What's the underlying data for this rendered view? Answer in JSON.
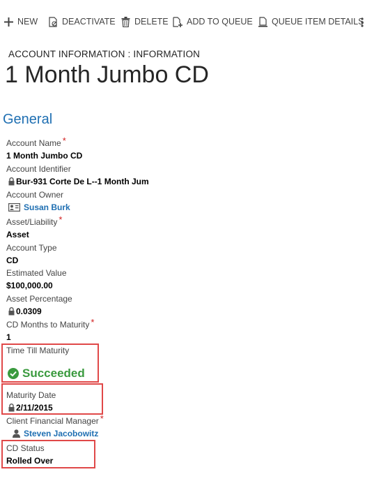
{
  "toolbar": {
    "new_label": "NEW",
    "deactivate_label": "DEACTIVATE",
    "delete_label": "DELETE",
    "add_to_queue_label": "ADD TO QUEUE",
    "queue_item_details_label": "QUEUE ITEM DETAILS"
  },
  "header": {
    "breadcrumb": "ACCOUNT INFORMATION : INFORMATION",
    "title": "1 Month Jumbo CD"
  },
  "section": {
    "title": "General"
  },
  "fields": {
    "account_name": {
      "label": "Account Name",
      "required": "*",
      "value": "1 Month Jumbo CD"
    },
    "account_identifier": {
      "label": "Account Identifier",
      "value": "Bur-931 Corte De L--1 Month Jum"
    },
    "account_owner": {
      "label": "Account Owner",
      "value": "Susan Burk"
    },
    "asset_liability": {
      "label": "Asset/Liability",
      "required": "*",
      "value": "Asset"
    },
    "account_type": {
      "label": "Account Type",
      "value": "CD"
    },
    "estimated_value": {
      "label": "Estimated Value",
      "value": "$100,000.00"
    },
    "asset_percentage": {
      "label": "Asset Percentage",
      "value": "0.0309"
    },
    "cd_months_to_maturity": {
      "label": "CD Months to Maturity",
      "required": "*",
      "value": "1"
    },
    "time_till_maturity": {
      "label": "Time Till Maturity",
      "value": "Succeeded"
    },
    "maturity_date": {
      "label": "Maturity Date",
      "value": "2/11/2015"
    },
    "client_financial_manager": {
      "label": "Client Financial Manager",
      "required": "*",
      "value": "Steven Jacobowitz"
    },
    "cd_status": {
      "label": "CD Status",
      "value": "Rolled Over"
    }
  },
  "colors": {
    "link": "#1f6fb2",
    "required": "#d21f1f",
    "success": "#3a9a3e",
    "highlight_border": "#e04848"
  }
}
